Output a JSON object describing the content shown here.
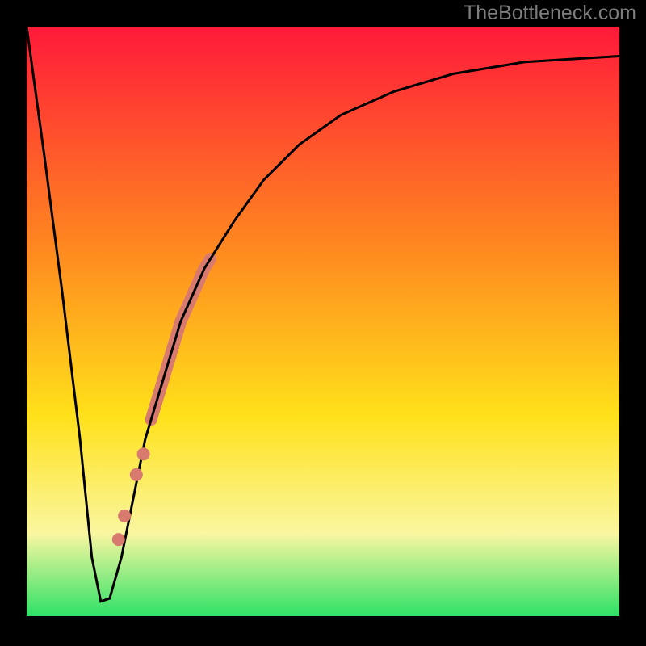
{
  "watermark": "TheBottleneck.com",
  "colors": {
    "frame": "#000000",
    "curve": "#000000",
    "dots": "#d87a6e",
    "gradient_top": "#ff1a3a",
    "gradient_mid1": "#ff8a1f",
    "gradient_mid2": "#ffe11a",
    "gradient_mid3": "#faf6a0",
    "gradient_bottom": "#2ee267"
  },
  "chart_data": {
    "type": "line",
    "title": "",
    "xlabel": "",
    "ylabel": "",
    "xlim": [
      0,
      100
    ],
    "ylim": [
      0,
      100
    ],
    "grid": false,
    "note": "Axes carry no printed ticks or labels; values are visual estimates on a 0–100 normalized scale where x runs left→right and y runs bottom→top of the plot area.",
    "series": [
      {
        "name": "bottleneck-curve",
        "x": [
          0,
          3,
          6,
          9,
          11,
          12.5,
          14,
          16,
          18,
          20,
          23,
          26,
          30,
          35,
          40,
          46,
          53,
          62,
          72,
          84,
          100
        ],
        "values": [
          100,
          78,
          55,
          30,
          10,
          2.5,
          3,
          10,
          20,
          30,
          40,
          50,
          59,
          67,
          74,
          80,
          85,
          89,
          92,
          94,
          95
        ]
      }
    ],
    "highlight_segment": {
      "name": "thick-salmon-band",
      "x_range": [
        21,
        31
      ],
      "y_range": [
        32,
        63
      ],
      "note": "Thick salmon overlay drawn along the ascending limb of the curve."
    },
    "dots": [
      {
        "x": 18.5,
        "y": 24
      },
      {
        "x": 19.7,
        "y": 27.5
      },
      {
        "x": 16.5,
        "y": 17
      },
      {
        "x": 15.5,
        "y": 13
      }
    ]
  }
}
